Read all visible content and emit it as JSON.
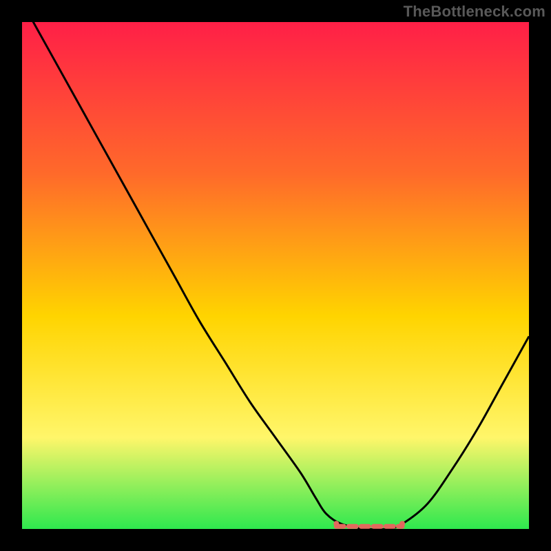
{
  "watermark": "TheBottleneck.com",
  "colors": {
    "frame_bg": "#000000",
    "grad_top": "#ff1f47",
    "grad_mid_upper": "#ff6a2a",
    "grad_mid": "#ffd400",
    "grad_mid_lower": "#fff66a",
    "grad_bottom": "#2ee84e",
    "curve": "#000000",
    "band": "#e1695d"
  },
  "chart_data": {
    "type": "line",
    "title": "",
    "xlabel": "",
    "ylabel": "",
    "xlim": [
      0,
      100
    ],
    "ylim": [
      0,
      100
    ],
    "x": [
      0,
      5,
      10,
      15,
      20,
      25,
      30,
      35,
      40,
      45,
      50,
      55,
      58,
      60,
      63,
      68,
      72,
      75,
      80,
      85,
      90,
      95,
      100
    ],
    "values": [
      104,
      95,
      86,
      77,
      68,
      59,
      50,
      41,
      33,
      25,
      18,
      11,
      6,
      3,
      1,
      0,
      0,
      1,
      5,
      12,
      20,
      29,
      38
    ],
    "flat_band": {
      "x_start": 62,
      "x_end": 75,
      "y": 0.5
    }
  }
}
